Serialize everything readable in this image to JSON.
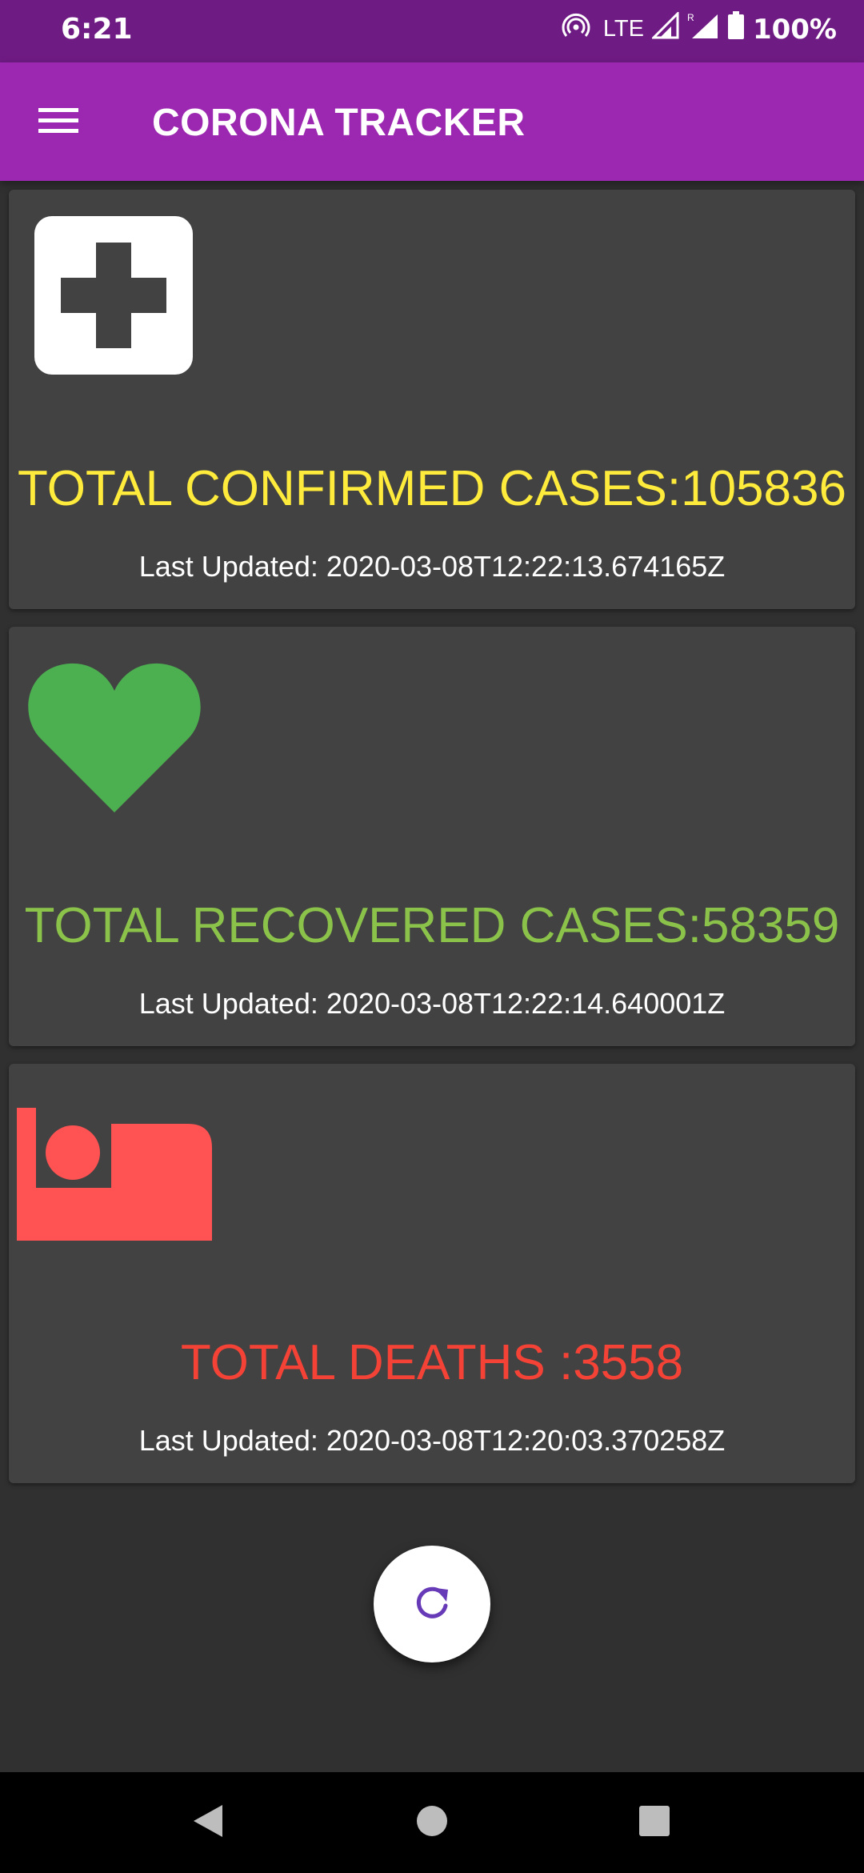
{
  "status_bar": {
    "time": "6:21",
    "network": "LTE",
    "battery_percent": "100%",
    "icons": [
      "hotspot-icon",
      "signal-icon",
      "roaming-signal-icon",
      "battery-icon"
    ]
  },
  "app_bar": {
    "title": "CORONA TRACKER",
    "menu_icon": "hamburger-menu-icon"
  },
  "cards": [
    {
      "icon": "medical-cross-icon",
      "count_text": "TOTAL CONFIRMED CASES:105836",
      "updated_text": "Last Updated: 2020-03-08T12:22:13.674165Z",
      "color": "#ffeb3b"
    },
    {
      "icon": "heart-icon",
      "count_text": "TOTAL RECOVERED CASES:58359",
      "updated_text": "Last Updated: 2020-03-08T12:22:14.640001Z",
      "color": "#8bc34a"
    },
    {
      "icon": "bed-icon",
      "count_text": "TOTAL DEATHS :3558",
      "updated_text": "Last Updated: 2020-03-08T12:20:03.370258Z",
      "color": "#f44336"
    }
  ],
  "fab": {
    "icon": "refresh-icon",
    "color": "#673ab7"
  },
  "nav_bar": {
    "icons": [
      "back-icon",
      "home-icon",
      "recents-icon"
    ]
  },
  "colors": {
    "status_bar": "#6f1b84",
    "app_bar": "#9c27b0",
    "background": "#303030",
    "card": "#424242"
  }
}
